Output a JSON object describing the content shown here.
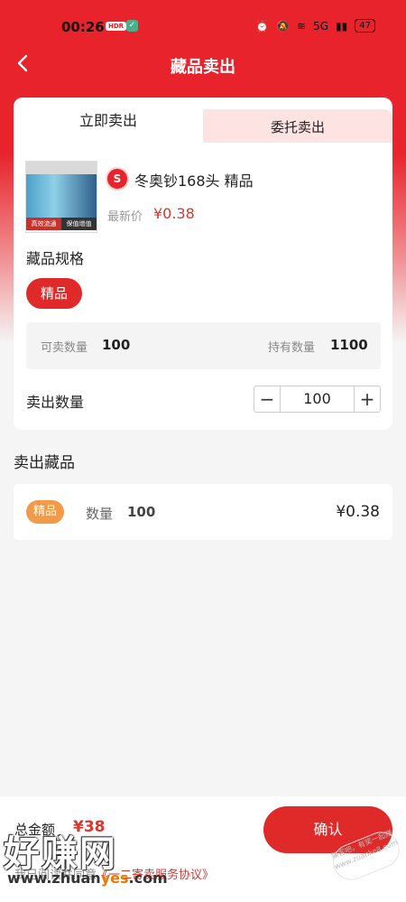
{
  "status_bar": {
    "time": "00:26",
    "badge": "HDR",
    "network": "5G",
    "battery": "47"
  },
  "nav": {
    "title": "藏品卖出"
  },
  "tabs": [
    {
      "label": "立即卖出",
      "active": true
    },
    {
      "label": "委托卖出",
      "active": false
    }
  ],
  "product": {
    "thumb_tags": [
      "高效流通",
      "保值增值"
    ],
    "coin_letter": "S",
    "name": "冬奥钞168头 精品",
    "price_label": "最新价",
    "price": "¥0.38"
  },
  "spec": {
    "label": "藏品规格",
    "selected": "精品"
  },
  "quantities": {
    "available_label": "可卖数量",
    "available": "100",
    "holding_label": "持有数量",
    "holding": "1100"
  },
  "sell": {
    "label": "卖出数量",
    "value": "100",
    "minus": "−",
    "plus": "+"
  },
  "sold_section": {
    "title": "卖出藏品",
    "items": [
      {
        "tag": "精品",
        "qty_label": "数量",
        "qty": "100",
        "price": "¥0.38"
      }
    ]
  },
  "footer": {
    "total_label": "总金额",
    "total": "¥38",
    "agreement_prefix": "我已阅读并同意",
    "agreement_link": "《一二寄卖服务协议》",
    "confirm": "确认"
  },
  "watermark": {
    "big": "好赚网",
    "small_prefix": "www.zhuan",
    "small_accent": "yes",
    "small_suffix": ".com",
    "stamp": "赚客吧，有奖一起赚 www.zuanke8.com"
  },
  "colors": {
    "brand_red": "#e8232c",
    "price_red": "#d9362e",
    "tag_orange": "#f09a4a"
  }
}
